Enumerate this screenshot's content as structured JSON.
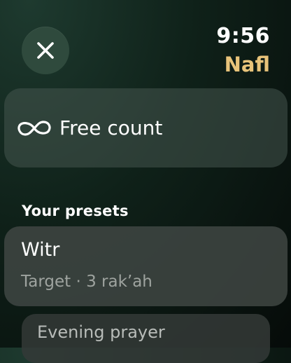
{
  "header": {
    "close_icon": "close-icon",
    "time": "9:56",
    "mode": "Nafl",
    "mode_color": "#e8c37a"
  },
  "free_count": {
    "icon": "infinity-icon",
    "label": "Free count"
  },
  "presets": {
    "title": "Your presets",
    "items": [
      {
        "name": "Witr",
        "meta": "Target · 3 rak’ah"
      },
      {
        "name": "Evening prayer"
      }
    ]
  }
}
